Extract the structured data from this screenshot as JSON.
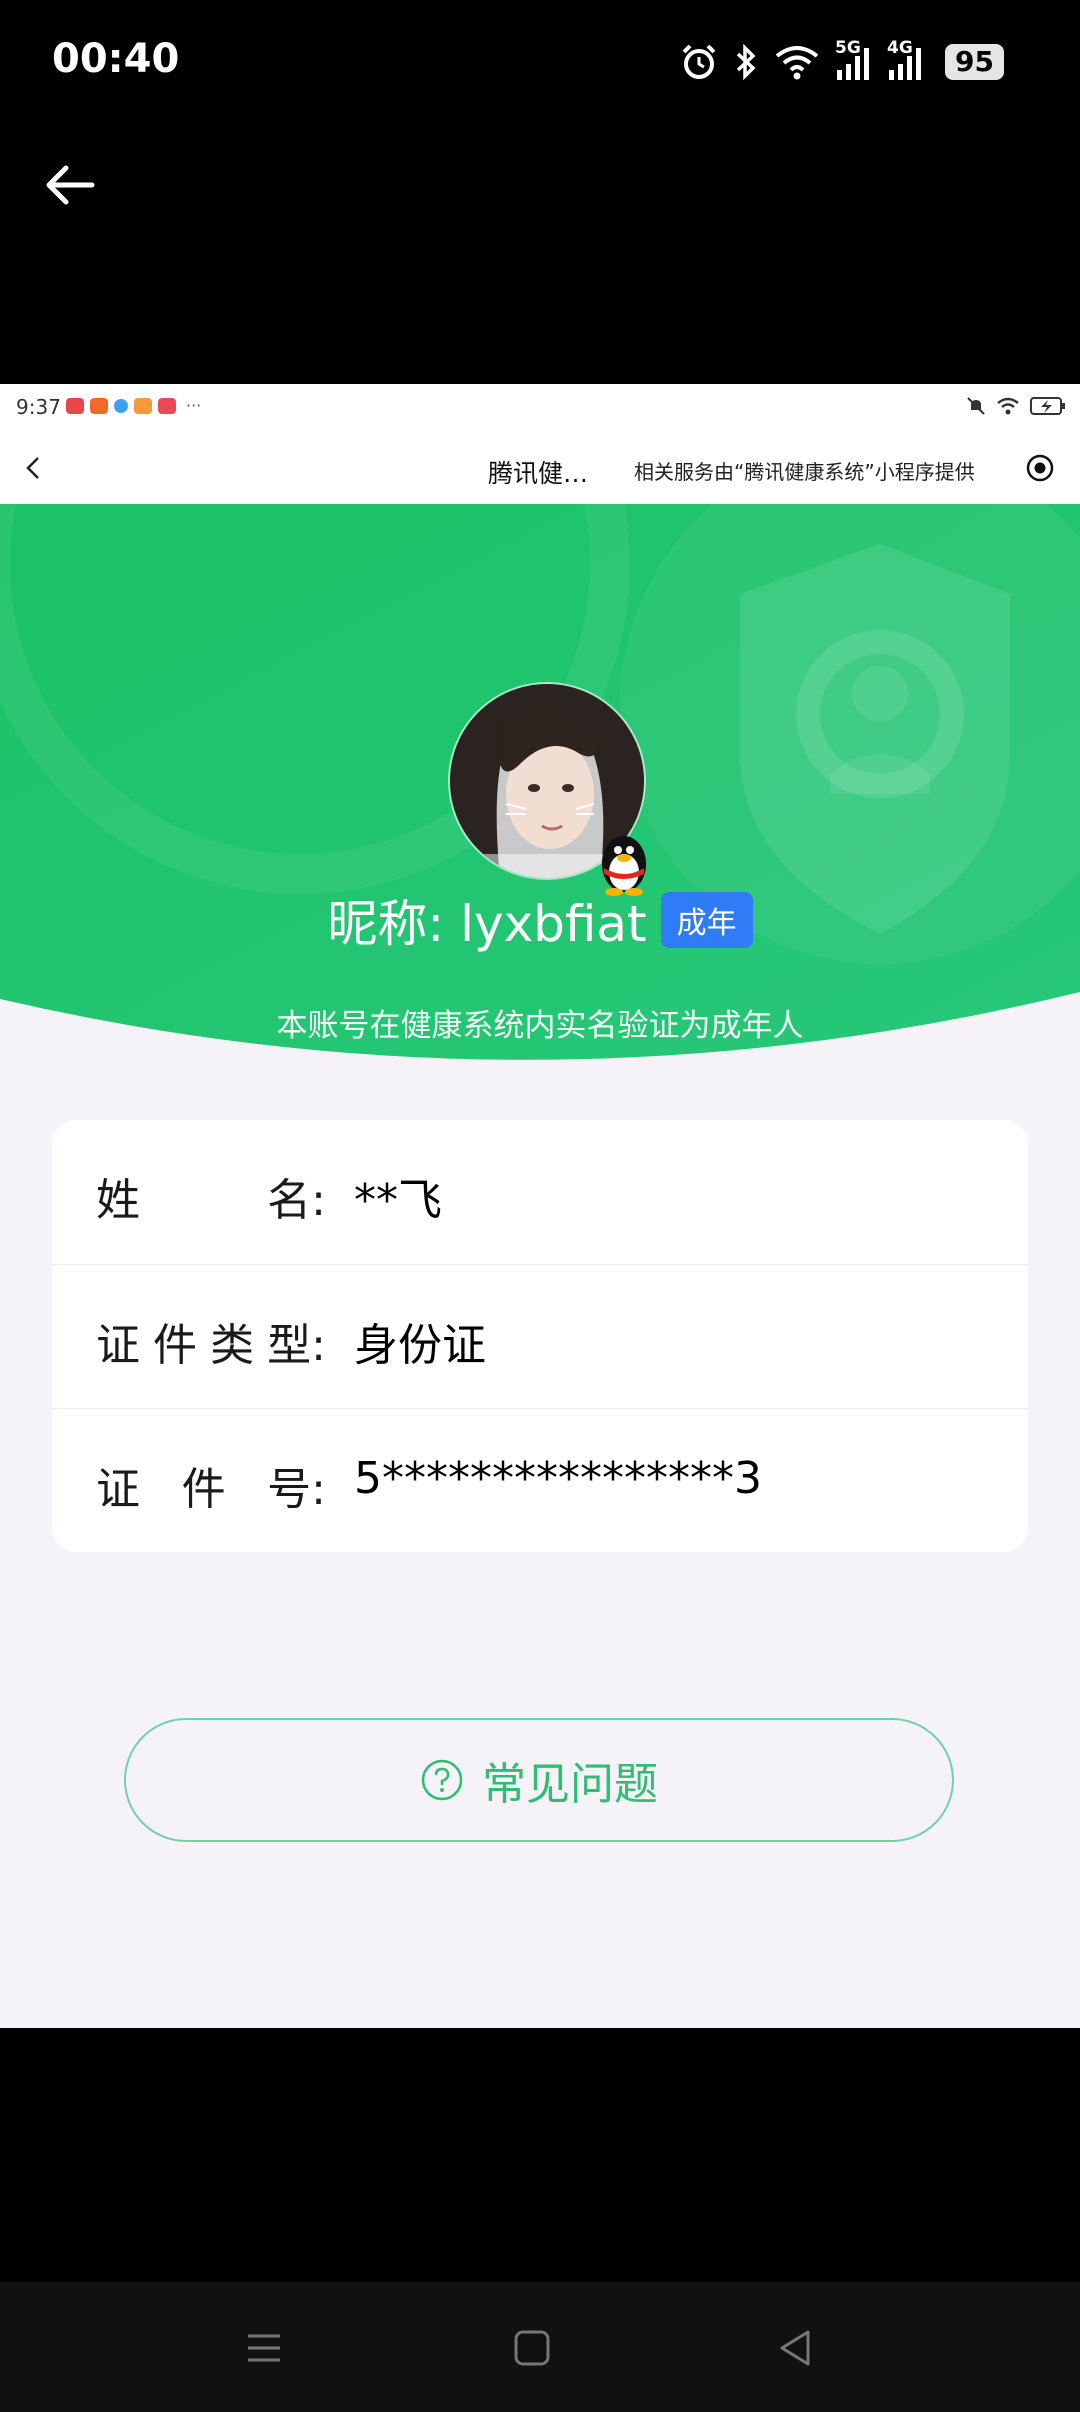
{
  "status_bar": {
    "time": "00:40",
    "network_1": "5G",
    "network_2": "4G",
    "battery": "95",
    "icons": [
      "alarm-icon",
      "bluetooth-icon",
      "wifi-icon",
      "signal-icon",
      "signal-icon"
    ]
  },
  "embedded_status": {
    "time": "9:37",
    "more": "···",
    "app_colors": [
      "#e8474a",
      "#f06a2a",
      "#3aa0f0",
      "#f39a3b",
      "#e84b55"
    ]
  },
  "miniapp_nav": {
    "title": "腾讯健…",
    "provider": "相关服务由“腾讯健康系统”小程序提供"
  },
  "profile": {
    "nickname": "昵称: lyxbfiat",
    "badge": "成年",
    "note": "本账号在健康系统内实名验证为成年人"
  },
  "info": {
    "rows": [
      {
        "label": [
          "姓",
          "名:"
        ],
        "value": "**飞"
      },
      {
        "label": [
          "证",
          "件",
          "类",
          "型:"
        ],
        "value": "身份证"
      },
      {
        "label": [
          "证",
          "件",
          "号:"
        ],
        "value": "5****************3"
      }
    ]
  },
  "faq": {
    "label": "常见问题"
  },
  "colors": {
    "banner_green": "#1fc46b",
    "badge_blue": "#2f7cf6",
    "faq_green": "#2fbc73",
    "page_bg": "#f5f3f7"
  }
}
